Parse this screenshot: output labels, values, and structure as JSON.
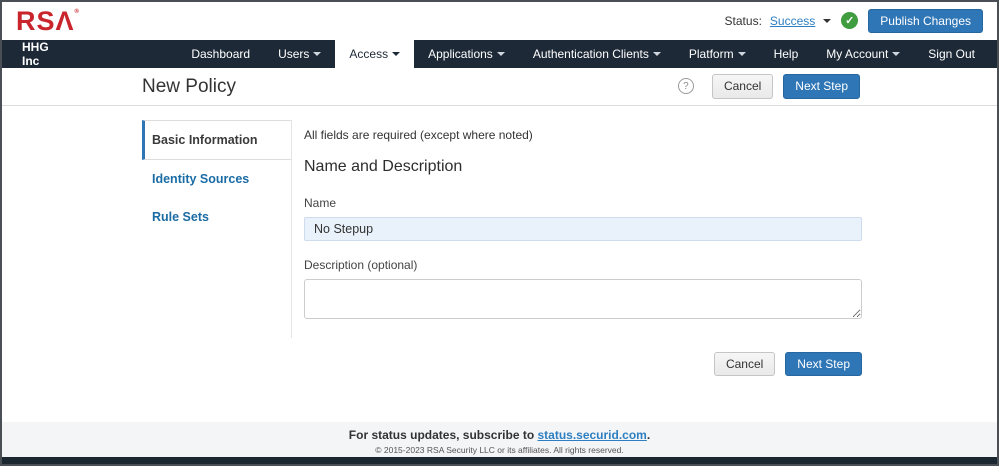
{
  "brand": {
    "logo_text": "RSΛ",
    "logo_reg": "®",
    "logo_color": "#c9252c"
  },
  "statusbar": {
    "status_label": "Status:",
    "status_value": "Success",
    "success_check": "✓",
    "publish_button": "Publish Changes"
  },
  "nav": {
    "company": "HHG Inc",
    "items": [
      {
        "label": "Dashboard",
        "caret": false,
        "active": false
      },
      {
        "label": "Users",
        "caret": true,
        "active": false
      },
      {
        "label": "Access",
        "caret": true,
        "active": true
      },
      {
        "label": "Applications",
        "caret": true,
        "active": false
      },
      {
        "label": "Authentication Clients",
        "caret": true,
        "active": false
      },
      {
        "label": "Platform",
        "caret": true,
        "active": false
      }
    ],
    "right_items": [
      {
        "label": "Help",
        "caret": false
      },
      {
        "label": "My Account",
        "caret": true
      },
      {
        "label": "Sign Out",
        "caret": false
      }
    ]
  },
  "page": {
    "title": "New Policy",
    "help_glyph": "?",
    "cancel_label": "Cancel",
    "next_label": "Next Step"
  },
  "sidebar": {
    "items": [
      {
        "label": "Basic Information",
        "active": true
      },
      {
        "label": "Identity Sources",
        "active": false
      },
      {
        "label": "Rule Sets",
        "active": false
      }
    ]
  },
  "form": {
    "required_note": "All fields are required (except where noted)",
    "section_title": "Name and Description",
    "name_label": "Name",
    "name_value": "No Stepup",
    "description_label": "Description (optional)",
    "description_value": "",
    "cancel_label": "Cancel",
    "next_label": "Next Step"
  },
  "footer": {
    "status_text": "For status updates, subscribe to ",
    "status_link": "status.securid.com",
    "status_suffix": ".",
    "copyright": "© 2015-2023 RSA Security LLC or its affiliates. All rights reserved."
  },
  "colors": {
    "brand_red": "#c9252c",
    "nav_dark": "#1d2936",
    "accent_blue": "#2f76b7",
    "link_blue": "#2d7fc1",
    "success_green": "#3f9c3f",
    "input_bg": "#e9f1fb"
  }
}
